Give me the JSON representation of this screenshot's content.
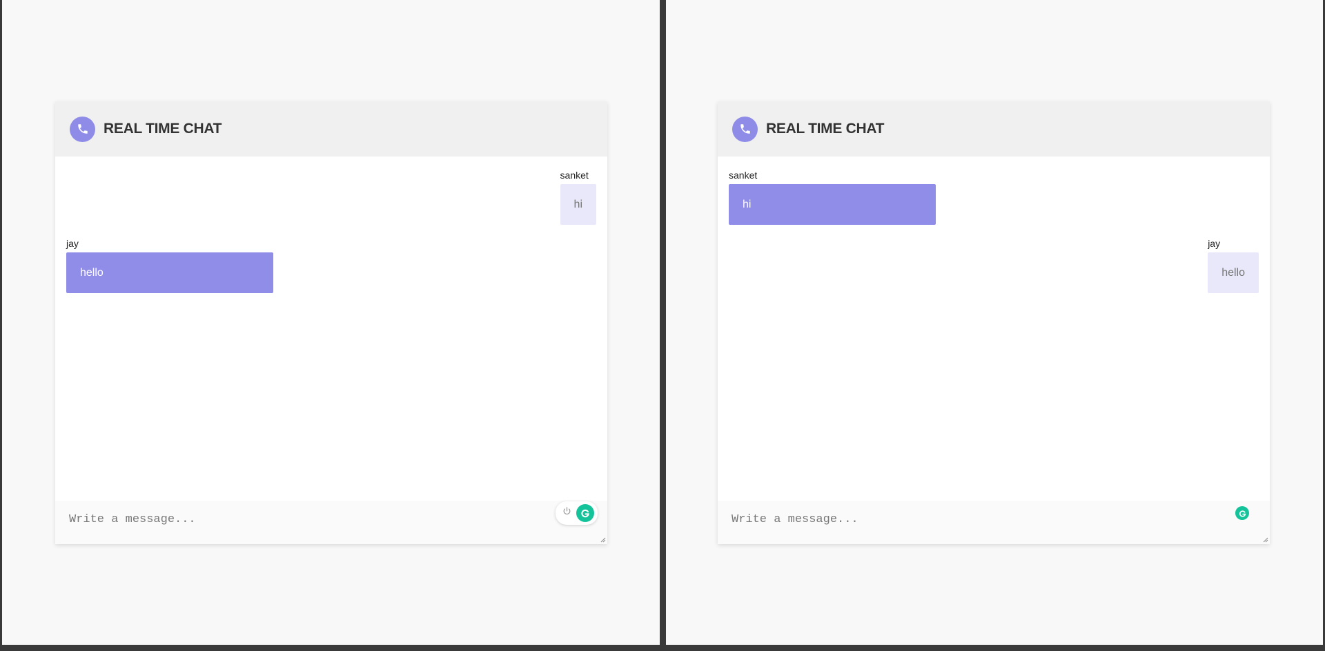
{
  "panes": [
    {
      "header": {
        "title": "REAL TIME CHAT",
        "icon": "phone-icon"
      },
      "messages": [
        {
          "sender": "sanket",
          "text": "hi",
          "side": "right"
        },
        {
          "sender": "jay",
          "text": "hello",
          "side": "left"
        }
      ],
      "input": {
        "placeholder": "Write a message..."
      },
      "extension": {
        "power_icon": "power-icon",
        "grammarly_icon": "grammarly-icon"
      }
    },
    {
      "header": {
        "title": "REAL TIME CHAT",
        "icon": "phone-icon"
      },
      "messages": [
        {
          "sender": "sanket",
          "text": "hi",
          "side": "left"
        },
        {
          "sender": "jay",
          "text": "hello",
          "side": "right"
        }
      ],
      "input": {
        "placeholder": "Write a message..."
      },
      "extension": {
        "grammarly_icon": "grammarly-icon"
      }
    }
  ],
  "colors": {
    "accent": "#908de8",
    "outgoing_bubble": "#e8e8fa",
    "header_bg": "#f0f0f0",
    "grammarly": "#15c39a"
  }
}
